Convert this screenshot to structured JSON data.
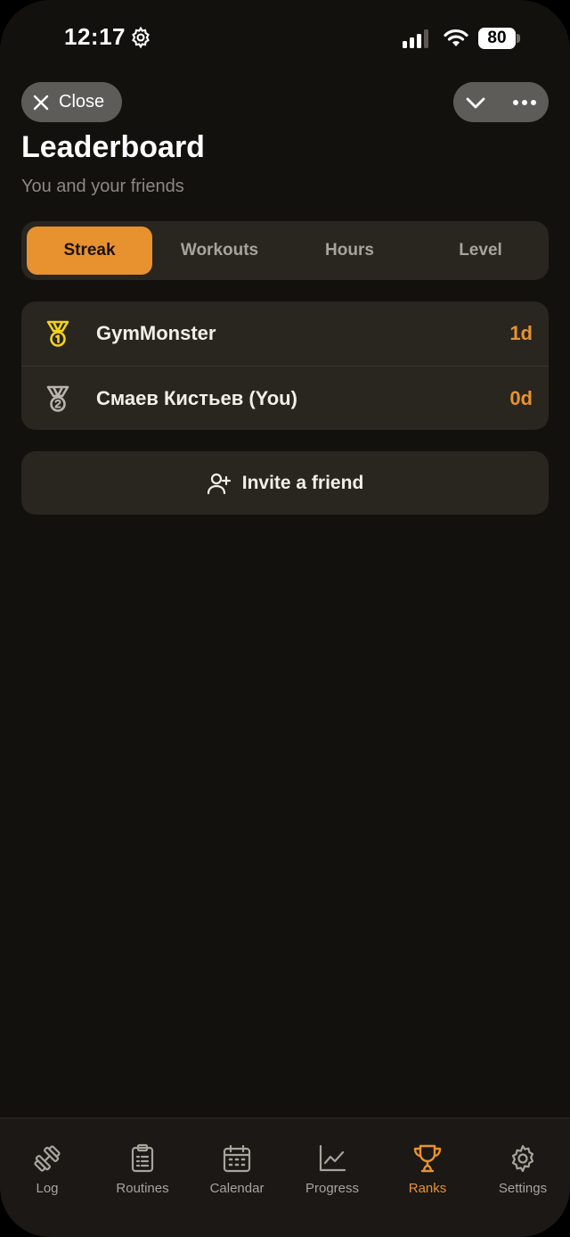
{
  "status_bar": {
    "time": "12:17",
    "battery": "80"
  },
  "header": {
    "close_label": "Close",
    "title": "Leaderboard",
    "subtitle": "You and your friends"
  },
  "segments": [
    {
      "label": "Streak",
      "active": true
    },
    {
      "label": "Workouts",
      "active": false
    },
    {
      "label": "Hours",
      "active": false
    },
    {
      "label": "Level",
      "active": false
    }
  ],
  "leaderboard": [
    {
      "name": "GymMonster",
      "value": "1d",
      "medal": "gold-medal-icon",
      "medal_color": "#f2d21c"
    },
    {
      "name": "Смаев Кистьев (You)",
      "value": "0d",
      "medal": "silver-medal-icon",
      "medal_color": "#b9b5ae"
    }
  ],
  "invite": {
    "label": "Invite a friend",
    "icon": "add-user-icon"
  },
  "tabs": [
    {
      "label": "Log",
      "icon": "dumbbell-icon",
      "active": false
    },
    {
      "label": "Routines",
      "icon": "clipboard-icon",
      "active": false
    },
    {
      "label": "Calendar",
      "icon": "calendar-icon",
      "active": false
    },
    {
      "label": "Progress",
      "icon": "chart-icon",
      "active": false
    },
    {
      "label": "Ranks",
      "icon": "trophy-icon",
      "active": true
    },
    {
      "label": "Settings",
      "icon": "settings-gear-icon",
      "active": false
    }
  ],
  "colors": {
    "accent": "#e8922f",
    "background": "#13110e",
    "card": "#29251f"
  }
}
